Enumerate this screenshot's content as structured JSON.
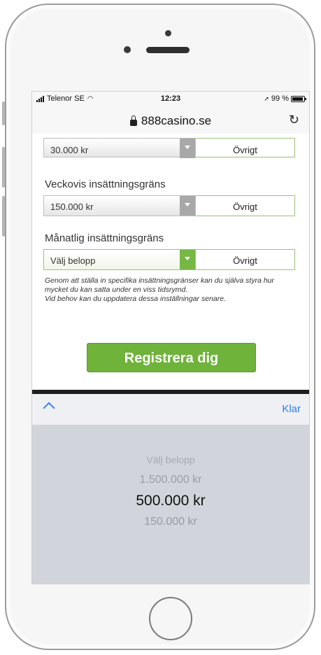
{
  "status": {
    "carrier": "Telenor SE",
    "time": "12:23",
    "battery": "99 %"
  },
  "browser": {
    "url": "888casino.se"
  },
  "form": {
    "prev_select": {
      "value": "30.000 kr",
      "other_label": "Övrigt"
    },
    "weekly": {
      "label": "Veckovis insättningsgräns",
      "value": "150.000 kr",
      "other_label": "Övrigt"
    },
    "monthly": {
      "label": "Månatlig insättningsgräns",
      "value": "Välj belopp",
      "other_label": "Övrigt"
    },
    "note_line1": "Genom att ställa in specifika insättningsgränser kan du själva styra hur mycket du kan satta under en viss tidsrymd.",
    "note_line2": "Vid behov kan du uppdatera dessa inställningar senare.",
    "register_label": "Registrera dig"
  },
  "keyboard_toolbar": {
    "done_label": "Klar"
  },
  "picker": {
    "options": [
      "Välj belopp",
      "1.500.000 kr",
      "500.000 kr",
      "150.000 kr"
    ],
    "selected": "500.000 kr"
  },
  "colors": {
    "accent_green": "#6fb33a",
    "ios_blue": "#2f7df6"
  }
}
